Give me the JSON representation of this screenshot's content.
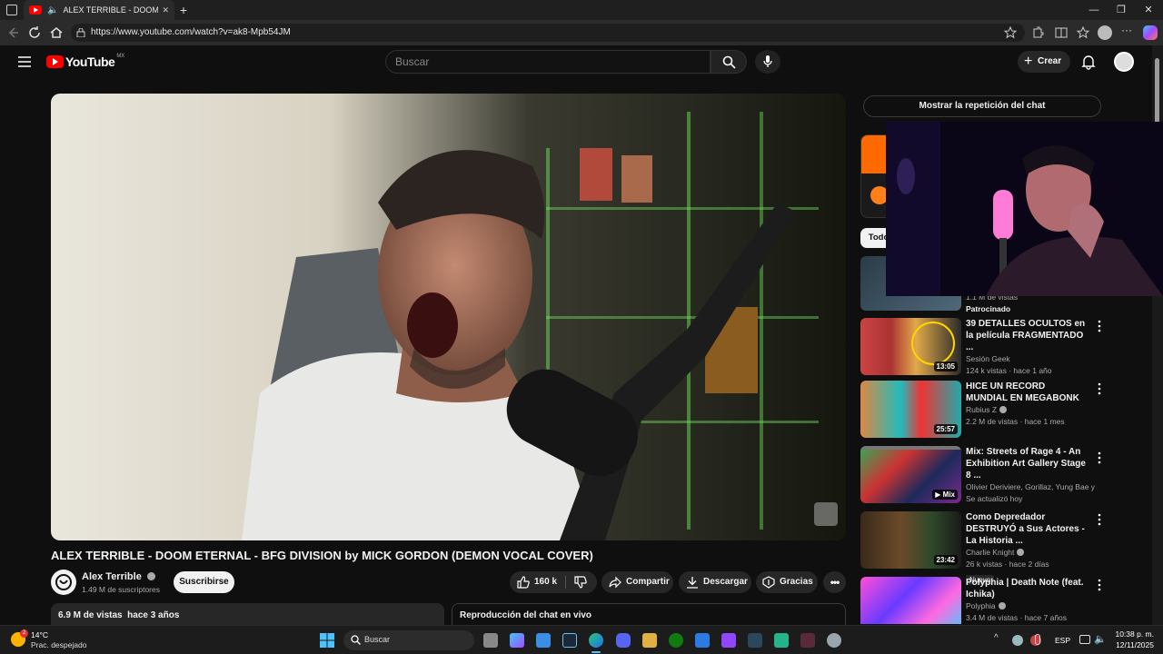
{
  "browser": {
    "tab_title": "ALEX TERRIBLE - DOOM ET",
    "url": "https://www.youtube.com/watch?v=ak8-Mpb54JM"
  },
  "masthead": {
    "logo_text": "YouTube",
    "region": "MX",
    "search_placeholder": "Buscar",
    "create_label": "Crear"
  },
  "video": {
    "title": "ALEX TERRIBLE - DOOM ETERNAL - BFG DIVISION by MICK GORDON (DEMON VOCAL COVER)",
    "channel": "Alex Terrible",
    "subscribers": "1.49 M de suscriptores",
    "subscribe_label": "Suscribirse",
    "likes": "160 k",
    "share_label": "Compartir",
    "download_label": "Descargar",
    "thanks_label": "Gracias",
    "views_line": "6.9 M de vistas  hace 3 años",
    "chat_replay_label": "Reproducción del chat en vivo"
  },
  "sidebar": {
    "show_chat_label": "Mostrar la repetición del chat",
    "filter_chip": "Todo",
    "partial_meta": "1.1 M de vistas",
    "sponsored": "Patrocinado",
    "items": [
      {
        "title": "39 DETALLES OCULTOS en la película FRAGMENTADO ...",
        "channel": "Sesión Geek",
        "meta": "124 k vistas · hace 1 año",
        "duration": "13:05",
        "badge": ""
      },
      {
        "title": "HICE UN RECORD MUNDIAL EN MEGABONK",
        "channel": "Rubius Z",
        "meta": "2.2 M de vistas · hace 1 mes",
        "duration": "25:57",
        "badge": ""
      },
      {
        "title": "Mix: Streets of Rage 4 - An Exhibition Art Gallery Stage 8 ...",
        "channel": "Olivier Deriviere, Gorillaz, Yung Bae y mu...",
        "meta": "Se actualizó hoy",
        "duration": "Mix",
        "badge": ""
      },
      {
        "title": "Como Depredador DESTRUYÓ a Sus Actores -  La Historia ...",
        "channel": "Charlie Knight",
        "meta": "26 k vistas · hace 2 días",
        "duration": "23:42",
        "badge": "Nuevo"
      },
      {
        "title": "Polyphia | Death Note (feat. Ichika)",
        "channel": "Polyphia",
        "meta": "3.4 M de vistas · hace 7 años",
        "duration": "",
        "badge": ""
      }
    ]
  },
  "taskbar": {
    "temp": "14°C",
    "weather": "Prac. despejado",
    "search_label": "Buscar",
    "lang": "ESP",
    "time": "10:38 p. m.",
    "date": "12/11/2025",
    "weather_badge": "2"
  },
  "colors": {
    "accent_red": "#ff0000",
    "bg": "#0f0f0f",
    "chip": "#272727"
  }
}
